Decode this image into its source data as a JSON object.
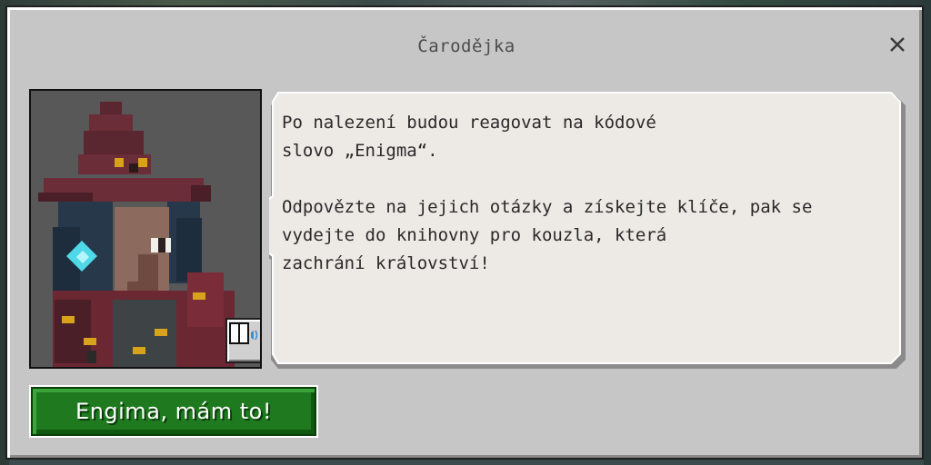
{
  "dialog": {
    "title": "Čarodějka",
    "close_icon": "close-icon",
    "message": "Po nalezení budou reagovat na kódové\nslovo „Enigma“.\n\nOdpovězte na jejich otázky a získejte klíče, pak se\nvydejte do knihovny pro kouzla, která\nzachrání království!",
    "action_button": "Engima, mám to!",
    "audio_icon": "read-aloud-icon",
    "portrait_icon": "witch-portrait"
  },
  "colors": {
    "panel": "#c6c6c6",
    "bubble": "#ede9e5",
    "button_green": "#1f7a1f"
  }
}
